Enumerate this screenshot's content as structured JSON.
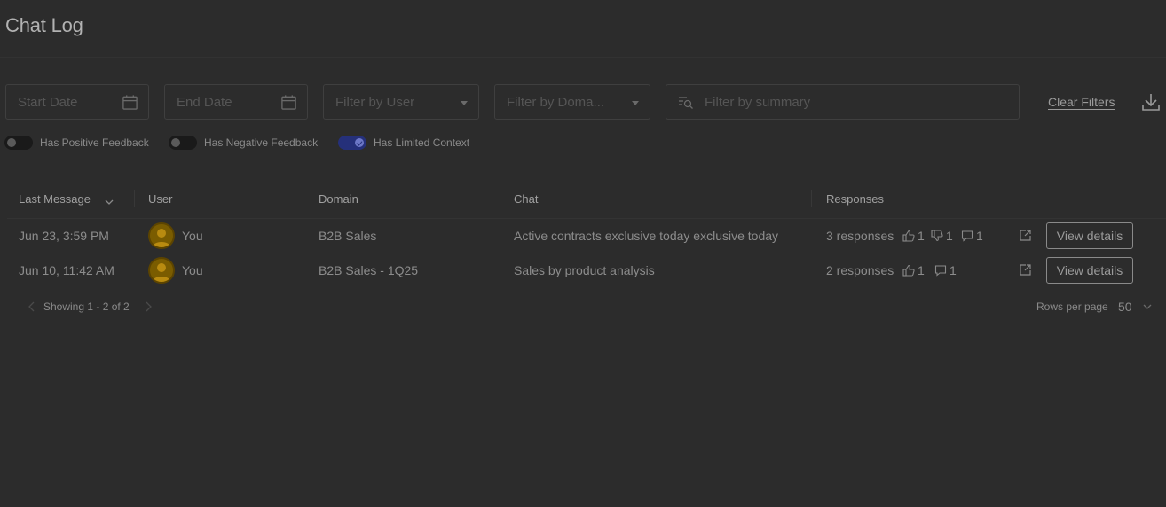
{
  "page": {
    "title": "Chat Log"
  },
  "filters": {
    "start_date": {
      "placeholder": "Start Date",
      "value": ""
    },
    "end_date": {
      "placeholder": "End Date",
      "value": ""
    },
    "user": {
      "placeholder": "Filter by User"
    },
    "domain": {
      "placeholder": "Filter by Doma..."
    },
    "summary": {
      "placeholder": "Filter by summary",
      "value": ""
    },
    "clear_label": "Clear Filters"
  },
  "toggles": [
    {
      "label": "Has Positive Feedback",
      "on": false
    },
    {
      "label": "Has Negative Feedback",
      "on": false
    },
    {
      "label": "Has Limited Context",
      "on": true
    }
  ],
  "table": {
    "columns": [
      "Last Message",
      "User",
      "Domain",
      "Chat",
      "Responses"
    ],
    "sorted_column": "Last Message",
    "rows": [
      {
        "last_message": "Jun 23, 3:59 PM",
        "user": "You",
        "domain": "B2B Sales",
        "chat": "Active contracts exclusive today exclusive today",
        "responses": "3 responses",
        "thumbs_up": "1",
        "thumbs_down": "1",
        "comments": "1",
        "action": "View details"
      },
      {
        "last_message": "Jun 10, 11:42 AM",
        "user": "You",
        "domain": "B2B Sales - 1Q25",
        "chat": "Sales by product analysis",
        "responses": "2 responses",
        "thumbs_up": "1",
        "comments": "1",
        "action": "View details"
      }
    ]
  },
  "pagination": {
    "showing": "Showing 1 - 2 of 2",
    "rows_per_page_label": "Rows per page",
    "rows_per_page": "50"
  },
  "colors": {
    "background": "#2c2c2c",
    "toggle_on": "#25307a",
    "avatar": "#7a5c00"
  }
}
